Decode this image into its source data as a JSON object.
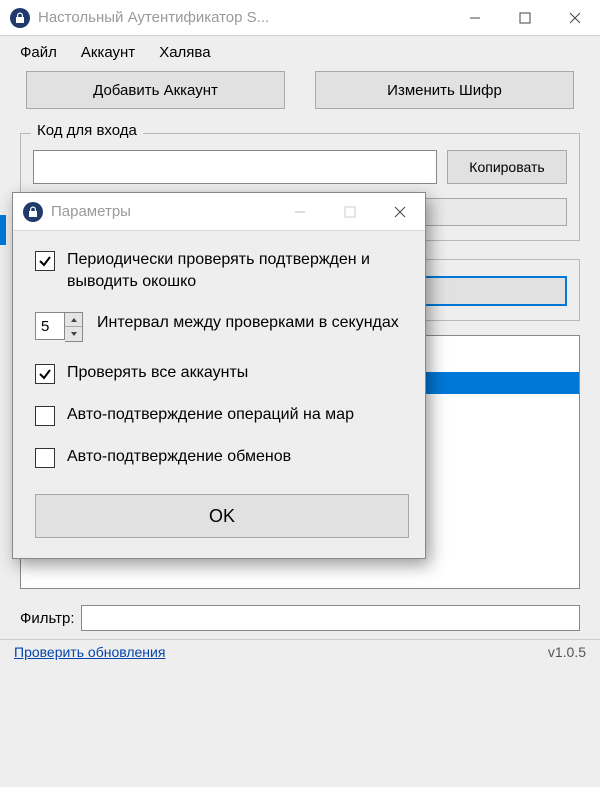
{
  "main": {
    "title": "Настольный Аутентификатор S...",
    "menu": {
      "file": "Файл",
      "account": "Аккаунт",
      "donate": "Халява"
    },
    "buttons": {
      "add_account": "Добавить Аккаунт",
      "change_passkey": "Изменить Шифр"
    },
    "login_group": {
      "label": "Код для входа",
      "copy": "Копировать"
    },
    "filter": {
      "label": "Фильтр:"
    },
    "footer": {
      "update_link": "Проверить обновления",
      "version": "v1.0.5"
    }
  },
  "modal": {
    "title": "Параметры",
    "options": {
      "periodic_check": "Периодически проверять подтвержден и выводить окошко",
      "interval_value": "5",
      "interval_label": "Интервал между проверками в секундах",
      "check_all": "Проверять все аккаунты",
      "auto_market": "Авто-подтверждение операций на мар",
      "auto_trades": "Авто-подтверждение обменов"
    },
    "ok": "OK"
  }
}
